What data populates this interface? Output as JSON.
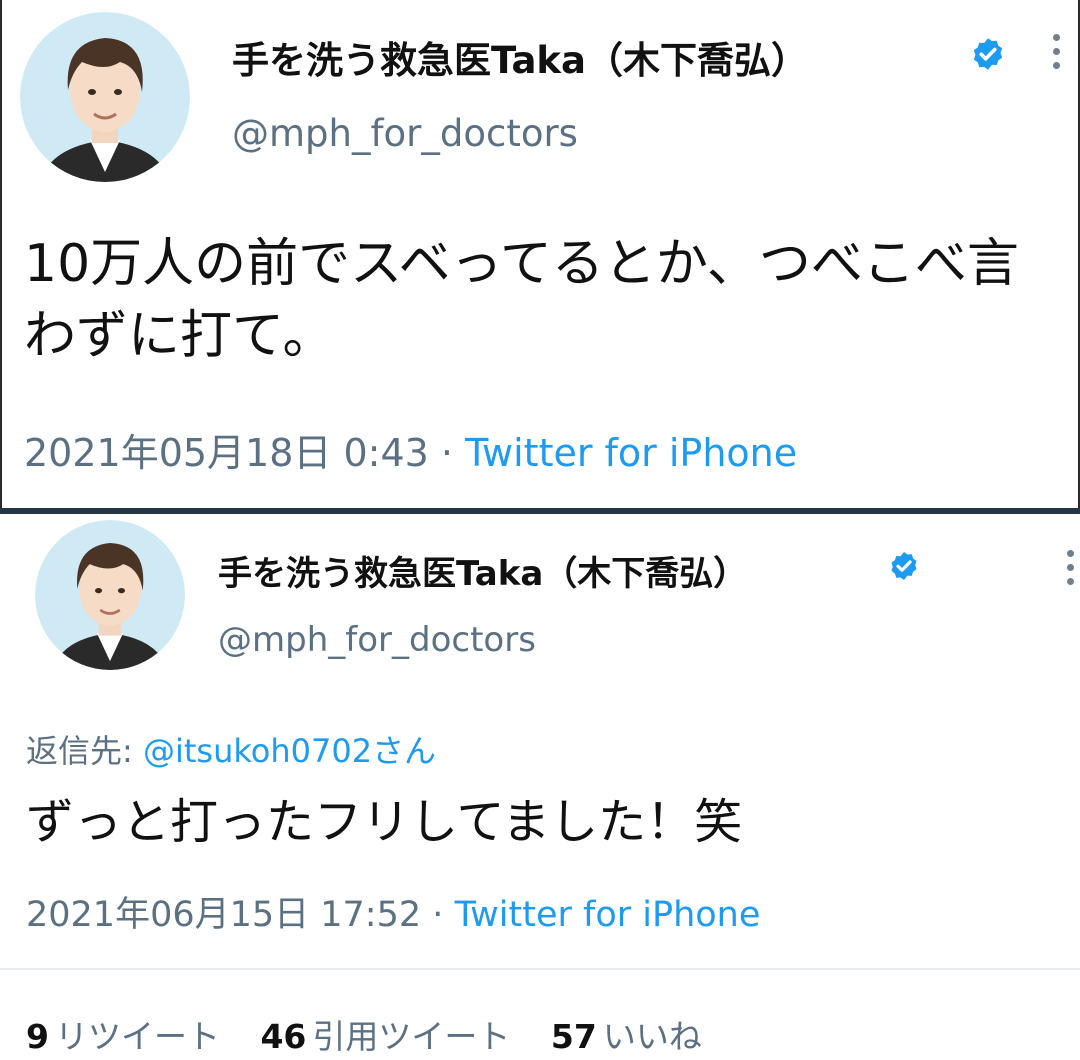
{
  "tweet1": {
    "display_name": "手を洗う救急医Taka（木下喬弘）",
    "handle": "@mph_for_doctors",
    "text": "10万人の前でスベってるとか、つべこべ言わずに打て。",
    "timestamp": "2021年05月18日 0:43",
    "separator": "·",
    "source": "Twitter for iPhone"
  },
  "tweet2": {
    "display_name": "手を洗う救急医Taka（木下喬弘）",
    "handle": "@mph_for_doctors",
    "reply_label": "返信先:",
    "reply_mention": "@itsukoh0702さん",
    "text": "ずっと打ったフリしてました！笑",
    "timestamp": "2021年06月15日 17:52",
    "separator": "·",
    "source": "Twitter for iPhone",
    "stats": {
      "retweets_count": "9",
      "retweets_label": "リツイート",
      "quotes_count": "46",
      "quotes_label": "引用ツイート",
      "likes_count": "57",
      "likes_label": "いいね"
    }
  },
  "colors": {
    "verified": "#1d9bf0",
    "link": "#1d9bf0",
    "secondary_text": "#5b7083",
    "divider": "#243345"
  },
  "icons": [
    "avatar",
    "verified-badge-icon",
    "more-options-icon"
  ]
}
